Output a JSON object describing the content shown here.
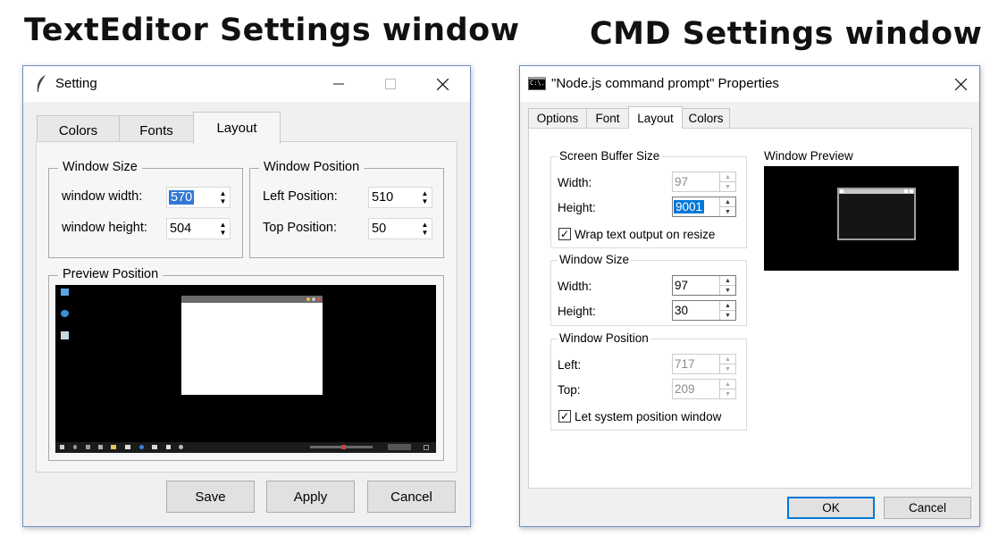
{
  "headings": {
    "left": "TextEditor Settings window",
    "right": "CMD Settings window"
  },
  "texteditor": {
    "title": "Setting",
    "tabs": [
      {
        "label": "Colors",
        "active": false
      },
      {
        "label": "Fonts",
        "active": false
      },
      {
        "label": "Layout",
        "active": true
      }
    ],
    "window_size": {
      "label": "Window Size",
      "width_label": "window width:",
      "width_value": "570",
      "height_label": "window height:",
      "height_value": "504"
    },
    "window_position": {
      "label": "Window Position",
      "left_label": "Left Position:",
      "left_value": "510",
      "top_label": "Top Position:",
      "top_value": "50"
    },
    "preview_label": "Preview Position",
    "buttons": {
      "save": "Save",
      "apply": "Apply",
      "cancel": "Cancel"
    }
  },
  "cmd": {
    "title": "\"Node.js command prompt\" Properties",
    "title_icon_text": "C:\\.",
    "tabs": [
      {
        "label": "Options",
        "active": false
      },
      {
        "label": "Font",
        "active": false
      },
      {
        "label": "Layout",
        "active": true
      },
      {
        "label": "Colors",
        "active": false
      }
    ],
    "screen_buffer": {
      "label": "Screen Buffer Size",
      "width_label": "Width:",
      "width_value": "97",
      "height_label": "Height:",
      "height_value": "9001",
      "wrap_label": "Wrap text output on resize",
      "wrap_checked": true
    },
    "window_size": {
      "label": "Window Size",
      "width_label": "Width:",
      "width_value": "97",
      "height_label": "Height:",
      "height_value": "30"
    },
    "window_position": {
      "label": "Window Position",
      "left_label": "Left:",
      "left_value": "717",
      "top_label": "Top:",
      "top_value": "209",
      "system_label": "Let system position window",
      "system_checked": true
    },
    "preview_label": "Window Preview",
    "buttons": {
      "ok": "OK",
      "cancel": "Cancel"
    }
  },
  "colors": {
    "window_border": "#6b8fc5",
    "selection": "#0078d7",
    "preview_bg": "#000000"
  }
}
